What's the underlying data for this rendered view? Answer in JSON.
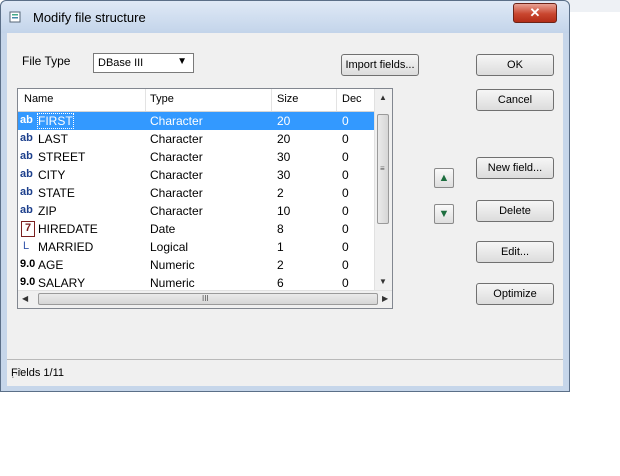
{
  "window": {
    "title": "Modify file structure",
    "close_glyph": "✕"
  },
  "file_type": {
    "label": "File Type",
    "value": "DBase III"
  },
  "buttons": {
    "import": "Import fields...",
    "ok": "OK",
    "cancel": "Cancel",
    "new_field": "New field...",
    "delete": "Delete",
    "edit": "Edit...",
    "optimize": "Optimize"
  },
  "grid": {
    "columns": [
      "Name",
      "Type",
      "Size",
      "Dec"
    ],
    "rows": [
      {
        "icon": "ab",
        "icon_name": "character-field-icon",
        "name": "FIRST",
        "type": "Character",
        "size": "20",
        "dec": "0",
        "selected": true
      },
      {
        "icon": "ab",
        "icon_name": "character-field-icon",
        "name": "LAST",
        "type": "Character",
        "size": "20",
        "dec": "0"
      },
      {
        "icon": "ab",
        "icon_name": "character-field-icon",
        "name": "STREET",
        "type": "Character",
        "size": "30",
        "dec": "0"
      },
      {
        "icon": "ab",
        "icon_name": "character-field-icon",
        "name": "CITY",
        "type": "Character",
        "size": "30",
        "dec": "0"
      },
      {
        "icon": "ab",
        "icon_name": "character-field-icon",
        "name": "STATE",
        "type": "Character",
        "size": "2",
        "dec": "0"
      },
      {
        "icon": "ab",
        "icon_name": "character-field-icon",
        "name": "ZIP",
        "type": "Character",
        "size": "10",
        "dec": "0"
      },
      {
        "icon": "7",
        "icon_name": "date-field-icon",
        "name": "HIREDATE",
        "type": "Date",
        "size": "8",
        "dec": "0"
      },
      {
        "icon": "L",
        "icon_name": "logical-field-icon",
        "name": "MARRIED",
        "type": "Logical",
        "size": "1",
        "dec": "0"
      },
      {
        "icon": "9.0",
        "icon_name": "numeric-field-icon",
        "name": "AGE",
        "type": "Numeric",
        "size": "2",
        "dec": "0"
      },
      {
        "icon": "9.0",
        "icon_name": "numeric-field-icon",
        "name": "SALARY",
        "type": "Numeric",
        "size": "6",
        "dec": "0"
      }
    ],
    "hscroll_grip": "III"
  },
  "status": {
    "text": "Fields 1/11"
  },
  "colors": {
    "selection": "#3399ff",
    "titlebar": "#c3d4ea",
    "close": "#c9462f"
  }
}
